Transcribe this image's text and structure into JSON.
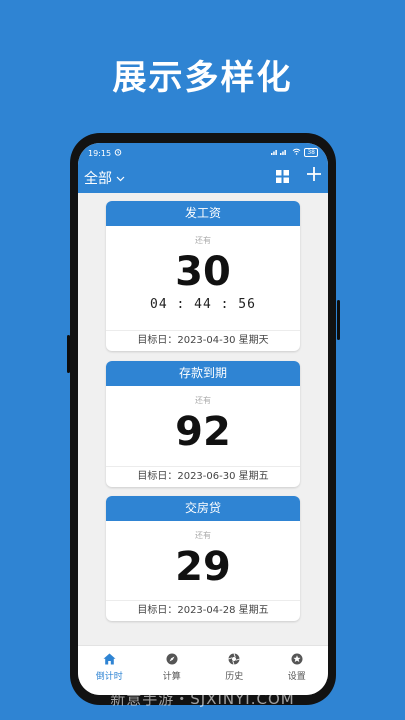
{
  "headline": "展示多样化",
  "status": {
    "time": "19:15",
    "battery": "38"
  },
  "toolbar": {
    "filter_label": "全部"
  },
  "cards": [
    {
      "title": "发工资",
      "remain_label": "还有",
      "days": "30",
      "timer": "04 : 44 : 56",
      "target": "目标日：2023-04-30 星期天"
    },
    {
      "title": "存款到期",
      "remain_label": "还有",
      "days": "92",
      "target": "目标日：2023-06-30 星期五"
    },
    {
      "title": "交房贷",
      "remain_label": "还有",
      "days": "29",
      "target": "目标日：2023-04-28 星期五"
    }
  ],
  "tabs": [
    {
      "label": "倒计时",
      "icon": "home-icon",
      "active": true
    },
    {
      "label": "计算",
      "icon": "compass-icon"
    },
    {
      "label": "历史",
      "icon": "aperture-icon"
    },
    {
      "label": "设置",
      "icon": "star-badge-icon"
    }
  ],
  "colors": {
    "primary": "#2f84d3",
    "accent": "#f4a431"
  },
  "watermark": "新意手游・SJXINYI.COM"
}
